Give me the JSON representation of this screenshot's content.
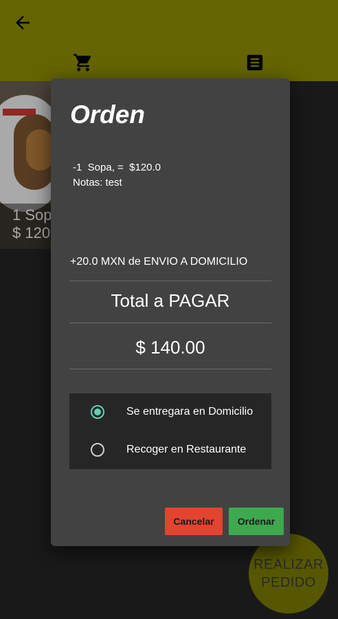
{
  "app_bar": {
    "back_icon": "arrow-back-icon",
    "tabs": [
      {
        "icon": "cart-icon"
      },
      {
        "icon": "list-icon"
      }
    ]
  },
  "background_card": {
    "item_name": "1 Sop",
    "item_price": "$ 120"
  },
  "fab": {
    "line1": "REALIZAR",
    "line2": "PEDIDO"
  },
  "dialog": {
    "title": "Orden",
    "order_line": "-1  Sopa, =  $120.0",
    "notes_line": "Notas: test",
    "shipping": "+20.0 MXN de ENVIO A DOMICILIO",
    "total_label": "Total a PAGAR",
    "total_value": "$ 140.00",
    "delivery_options": [
      {
        "label": "Se entregara en Domicilio",
        "checked": true
      },
      {
        "label": "Recoger en Restaurante",
        "checked": false
      }
    ],
    "cancel_label": "Cancelar",
    "order_label": "Ordenar"
  },
  "colors": {
    "app_bar": "#7a7a00",
    "dialog_bg": "#424242",
    "radio_accent": "#5fd1b0",
    "cancel": "#e2442f",
    "order": "#3ea84f"
  }
}
